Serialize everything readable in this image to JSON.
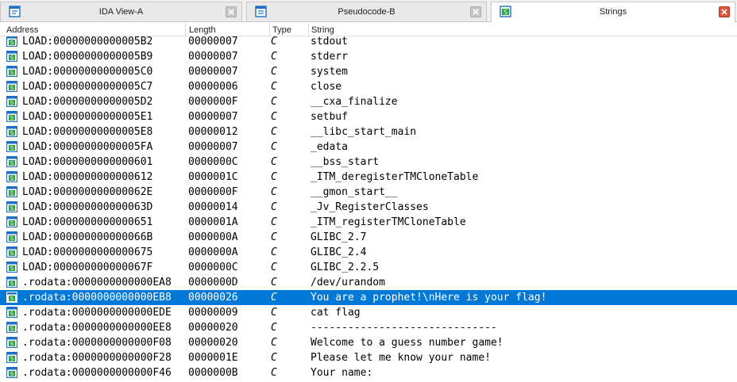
{
  "tabs": [
    {
      "label": "IDA View-A",
      "active": false
    },
    {
      "label": "Pseudocode-B",
      "active": false
    },
    {
      "label": "Strings",
      "active": true
    }
  ],
  "columns": {
    "address": "Address",
    "length": "Length",
    "type": "Type",
    "string": "String"
  },
  "rows": [
    {
      "address": "LOAD:00000000000005B2",
      "length": "00000007",
      "type": "C",
      "string": "stdout"
    },
    {
      "address": "LOAD:00000000000005B9",
      "length": "00000007",
      "type": "C",
      "string": "stderr"
    },
    {
      "address": "LOAD:00000000000005C0",
      "length": "00000007",
      "type": "C",
      "string": "system"
    },
    {
      "address": "LOAD:00000000000005C7",
      "length": "00000006",
      "type": "C",
      "string": "close"
    },
    {
      "address": "LOAD:00000000000005D2",
      "length": "0000000F",
      "type": "C",
      "string": "__cxa_finalize"
    },
    {
      "address": "LOAD:00000000000005E1",
      "length": "00000007",
      "type": "C",
      "string": "setbuf"
    },
    {
      "address": "LOAD:00000000000005E8",
      "length": "00000012",
      "type": "C",
      "string": "__libc_start_main"
    },
    {
      "address": "LOAD:00000000000005FA",
      "length": "00000007",
      "type": "C",
      "string": "_edata"
    },
    {
      "address": "LOAD:0000000000000601",
      "length": "0000000C",
      "type": "C",
      "string": "__bss_start"
    },
    {
      "address": "LOAD:0000000000000612",
      "length": "0000001C",
      "type": "C",
      "string": "_ITM_deregisterTMCloneTable"
    },
    {
      "address": "LOAD:000000000000062E",
      "length": "0000000F",
      "type": "C",
      "string": "__gmon_start__"
    },
    {
      "address": "LOAD:000000000000063D",
      "length": "00000014",
      "type": "C",
      "string": "_Jv_RegisterClasses"
    },
    {
      "address": "LOAD:0000000000000651",
      "length": "0000001A",
      "type": "C",
      "string": "_ITM_registerTMCloneTable"
    },
    {
      "address": "LOAD:000000000000066B",
      "length": "0000000A",
      "type": "C",
      "string": "GLIBC_2.7"
    },
    {
      "address": "LOAD:0000000000000675",
      "length": "0000000A",
      "type": "C",
      "string": "GLIBC_2.4"
    },
    {
      "address": "LOAD:000000000000067F",
      "length": "0000000C",
      "type": "C",
      "string": "GLIBC_2.2.5"
    },
    {
      "address": ".rodata:0000000000000EA8",
      "length": "0000000D",
      "type": "C",
      "string": "/dev/urandom"
    },
    {
      "address": ".rodata:0000000000000EB8",
      "length": "00000026",
      "type": "C",
      "string": "You are a prophet!\\nHere is your flag!",
      "selected": true
    },
    {
      "address": ".rodata:0000000000000EDE",
      "length": "00000009",
      "type": "C",
      "string": "cat flag"
    },
    {
      "address": ".rodata:0000000000000EE8",
      "length": "00000020",
      "type": "C",
      "string": "------------------------------"
    },
    {
      "address": ".rodata:0000000000000F08",
      "length": "00000020",
      "type": "C",
      "string": "Welcome to a guess number game!"
    },
    {
      "address": ".rodata:0000000000000F28",
      "length": "0000001E",
      "type": "C",
      "string": "Please let me know your name!"
    },
    {
      "address": ".rodata:0000000000000F46",
      "length": "0000000B",
      "type": "C",
      "string": "Your name:"
    }
  ],
  "colors": {
    "selection": "#0078d7",
    "close_active": "#e0533c",
    "icon_blue": "#1f6fc5",
    "icon_green": "#2f9e44"
  },
  "icons": {
    "tab_ida_view": "ida-view-icon",
    "tab_pseudocode": "pseudocode-icon",
    "tab_strings": "strings-icon",
    "row": "string-item-icon",
    "close": "close-icon"
  }
}
